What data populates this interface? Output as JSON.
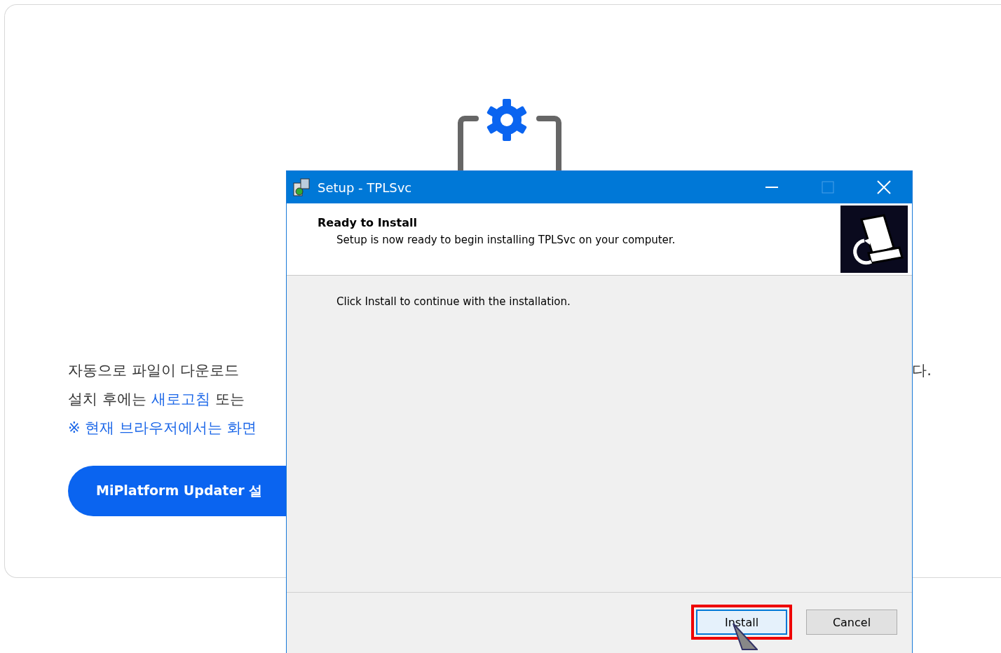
{
  "page": {
    "line_1": {
      "text": "자동으로 파일이 다운로드",
      "end": "다."
    },
    "line_2": [
      {
        "text": "설치 후에는",
        "link": false
      },
      {
        "text": "새로고침",
        "link": true
      },
      {
        "text": "또는",
        "link": false
      }
    ],
    "note": "※ 현재 브라우저에서는 화면",
    "install_button": "MiPlatform Updater 설"
  },
  "dialog": {
    "title": "Setup - TPLSvc",
    "heading": "Ready to Install",
    "subheading": "Setup is now ready to begin installing TPLSvc on your computer.",
    "body": "Click Install to continue with the installation.",
    "buttons": [
      {
        "label": "Install",
        "default": true,
        "highlighted": true
      },
      {
        "label": "Cancel",
        "default": false,
        "highlighted": false
      }
    ]
  }
}
